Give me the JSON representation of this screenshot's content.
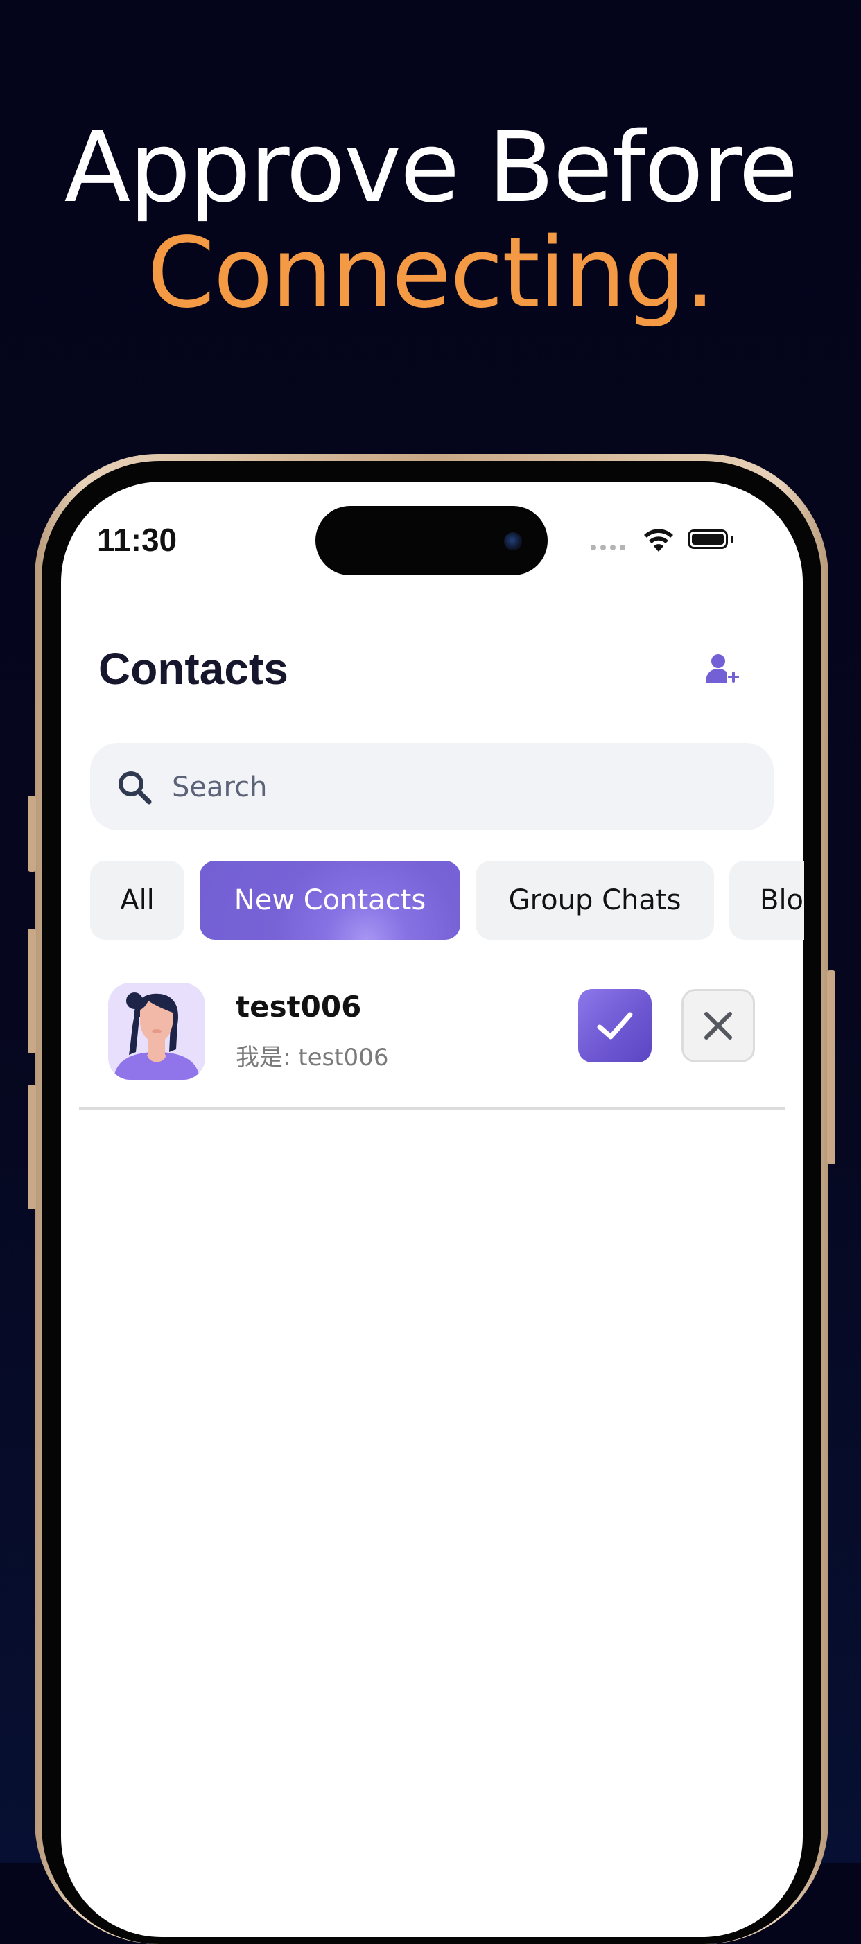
{
  "headline": {
    "line1": "Approve Before",
    "line2": "Connecting.",
    "line2_color": "#f49a45"
  },
  "status_bar": {
    "time": "11:30",
    "icons": [
      "cellular-dots-icon",
      "wifi-icon",
      "battery-icon"
    ]
  },
  "header": {
    "title": "Contacts",
    "action_icon": "add-person-icon"
  },
  "search": {
    "placeholder": "Search",
    "value": ""
  },
  "tabs": [
    {
      "label": "All",
      "active": false
    },
    {
      "label": "New Contacts",
      "active": true
    },
    {
      "label": "Group Chats",
      "active": false
    },
    {
      "label": "Blo",
      "active": false
    }
  ],
  "contacts": [
    {
      "name": "test006",
      "message": "我是: test006",
      "avatar": "woman-avatar",
      "accept_icon": "check-icon",
      "reject_icon": "close-icon"
    }
  ],
  "colors": {
    "accent": "#7360d4",
    "background": "#04041a"
  }
}
